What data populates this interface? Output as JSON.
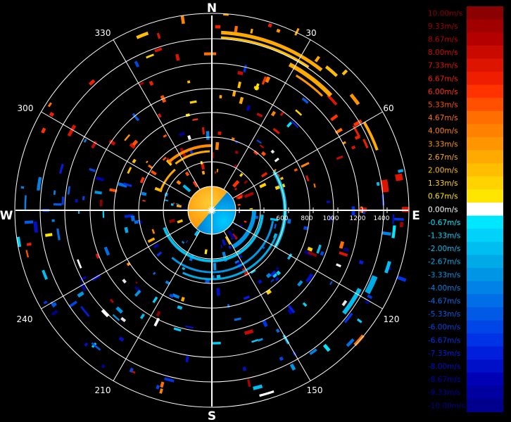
{
  "compass": {
    "north": "N",
    "east": "E",
    "south": "S",
    "west": "W"
  },
  "bearings": [
    "30",
    "60",
    "120",
    "150",
    "210",
    "240",
    "300",
    "330"
  ],
  "range_labels": [
    "600",
    "800",
    "1000",
    "1200",
    "1400"
  ],
  "legend": {
    "entries": [
      {
        "label": "10.00m/s",
        "color": "#8b0000"
      },
      {
        "label": "9.33m/s",
        "color": "#a00000"
      },
      {
        "label": "8.67m/s",
        "color": "#b40000"
      },
      {
        "label": "8.00m/s",
        "color": "#c80a00"
      },
      {
        "label": "7.33m/s",
        "color": "#dc1400"
      },
      {
        "label": "6.67m/s",
        "color": "#f01e00"
      },
      {
        "label": "6.00m/s",
        "color": "#ff3200"
      },
      {
        "label": "5.33m/s",
        "color": "#ff5000"
      },
      {
        "label": "4.67m/s",
        "color": "#ff6e00"
      },
      {
        "label": "4.00m/s",
        "color": "#ff8200"
      },
      {
        "label": "3.33m/s",
        "color": "#ff9600"
      },
      {
        "label": "2.67m/s",
        "color": "#ffaa00"
      },
      {
        "label": "2.00m/s",
        "color": "#ffbe00"
      },
      {
        "label": "1.33m/s",
        "color": "#ffd200"
      },
      {
        "label": "0.67m/s",
        "color": "#ffe600"
      },
      {
        "label": "0.00m/s",
        "color": "#ffffff"
      },
      {
        "label": "-0.67m/s",
        "color": "#00e6ff"
      },
      {
        "label": "-1.33m/s",
        "color": "#00d2fa"
      },
      {
        "label": "-2.00m/s",
        "color": "#00bef0"
      },
      {
        "label": "-2.67m/s",
        "color": "#00aae6"
      },
      {
        "label": "-3.33m/s",
        "color": "#0096e6"
      },
      {
        "label": "-4.00m/s",
        "color": "#0082e6"
      },
      {
        "label": "-4.67m/s",
        "color": "#006ee6"
      },
      {
        "label": "-5.33m/s",
        "color": "#005ae6"
      },
      {
        "label": "-6.00m/s",
        "color": "#0046e6"
      },
      {
        "label": "-6.67m/s",
        "color": "#0032e6"
      },
      {
        "label": "-7.33m/s",
        "color": "#001edc"
      },
      {
        "label": "-8.00m/s",
        "color": "#000fc8"
      },
      {
        "label": "-8.67m/s",
        "color": "#0000b4"
      },
      {
        "label": "-9.33m/s",
        "color": "#0000a0"
      },
      {
        "label": "-10.00m/s",
        "color": "#00008c"
      }
    ]
  }
}
